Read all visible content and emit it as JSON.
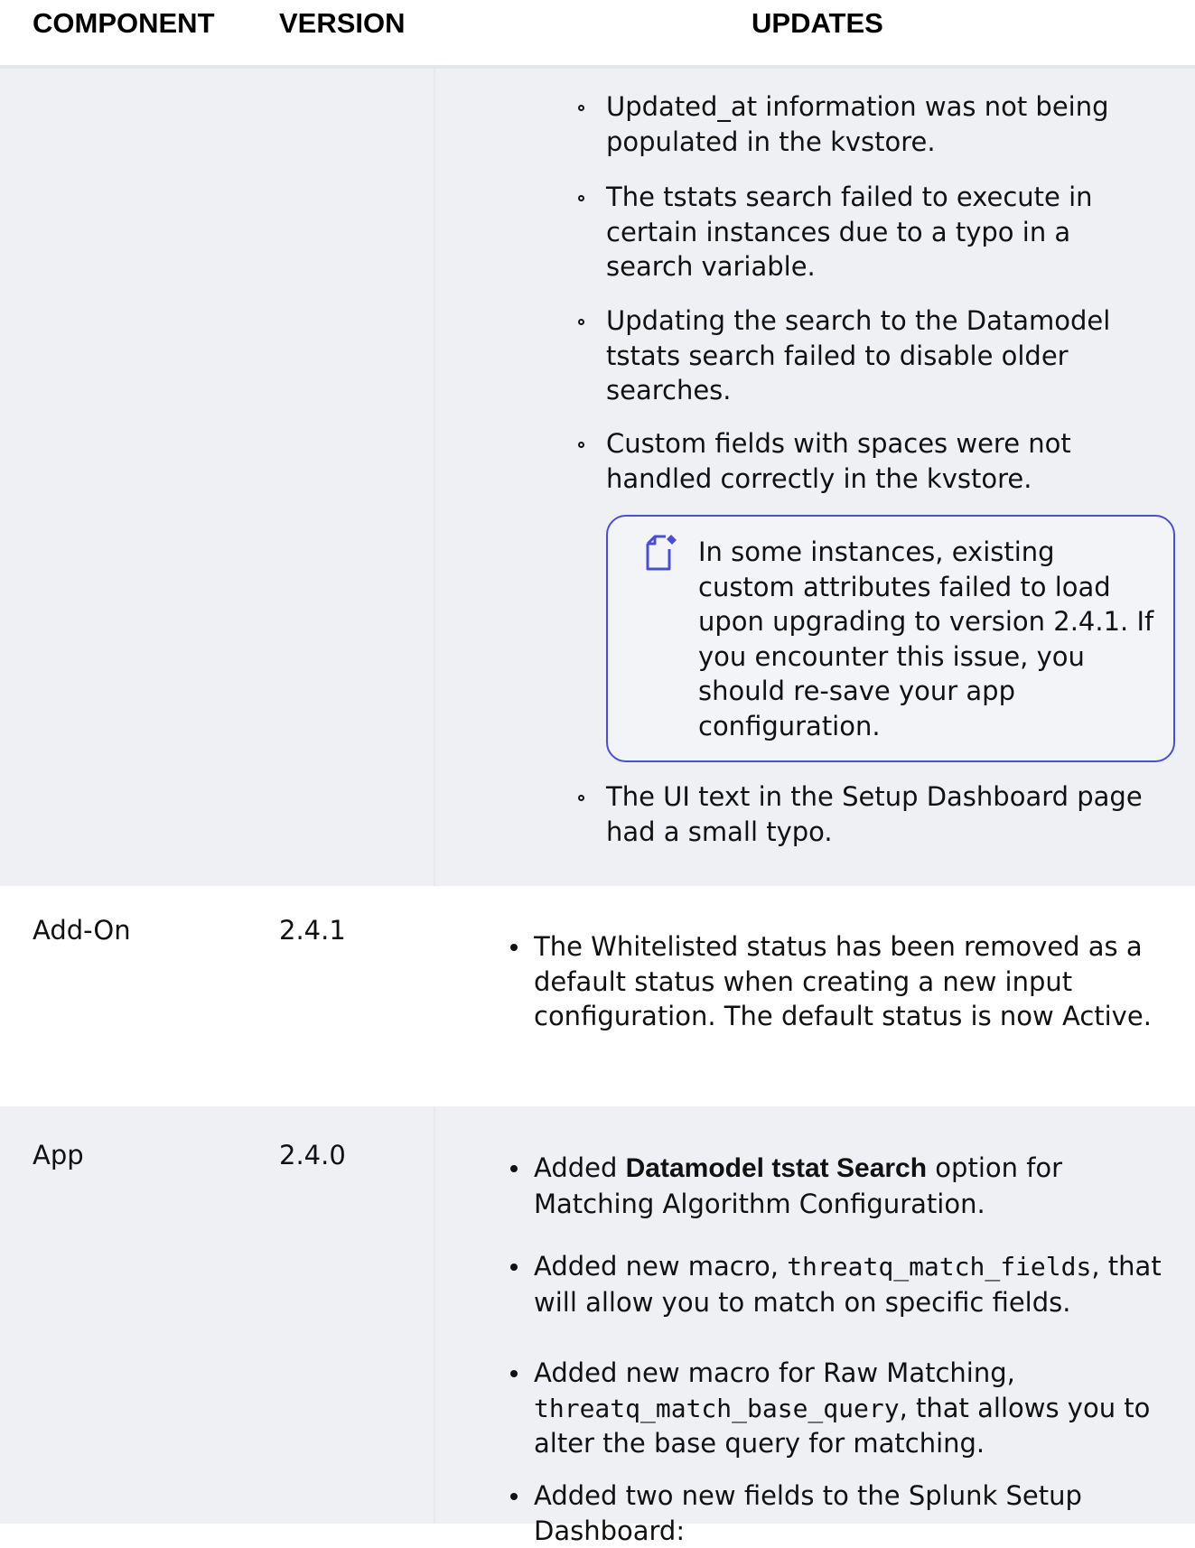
{
  "table": {
    "headers": {
      "component": "COMPONENT",
      "version": "VERSION",
      "updates": "UPDATES"
    }
  },
  "row_continued": {
    "items": [
      "Updated_at information was not being populated in the kvstore.",
      "The tstats search failed to execute in certain instances due to a typo in a search variable.",
      "Updating the search to the Datamodel tstats search failed to disable older searches.",
      "Custom fields with spaces were not handled correctly in the kvstore."
    ],
    "note": {
      "icon": "note-pencil-icon",
      "text": "In some instances, existing custom attributes failed to load upon upgrading to version 2.4.1. If you encounter this issue, you should re-save your app configuration."
    },
    "last_item": "The UI text in the Setup Dashboard page had a small typo."
  },
  "row_addon": {
    "component": "Add-On",
    "version": "2.4.1",
    "items": [
      "The Whitelisted status has been removed as a default status when creating a new input configuration.  The default status is now Active."
    ]
  },
  "row_app": {
    "component": "App",
    "version": "2.4.0",
    "item1": {
      "pre": "Added ",
      "bold": "Datamodel tstat Search",
      "post": " option for Matching Algorithm Configuration."
    },
    "item2": {
      "pre": "Added new macro, ",
      "code": "threatq_match_fields",
      "post": ", that will allow you to match on specific fields."
    },
    "item3": {
      "pre": "Added new macro for Raw Matching, ",
      "code": "threatq_match_base_query",
      "post": ", that allows you to alter the base query for matching."
    },
    "item4": "Added two new fields to the Splunk Setup Dashboard:"
  },
  "colors": {
    "shaded_row": "#eff0f4",
    "note_border": "#4b4fcf"
  }
}
